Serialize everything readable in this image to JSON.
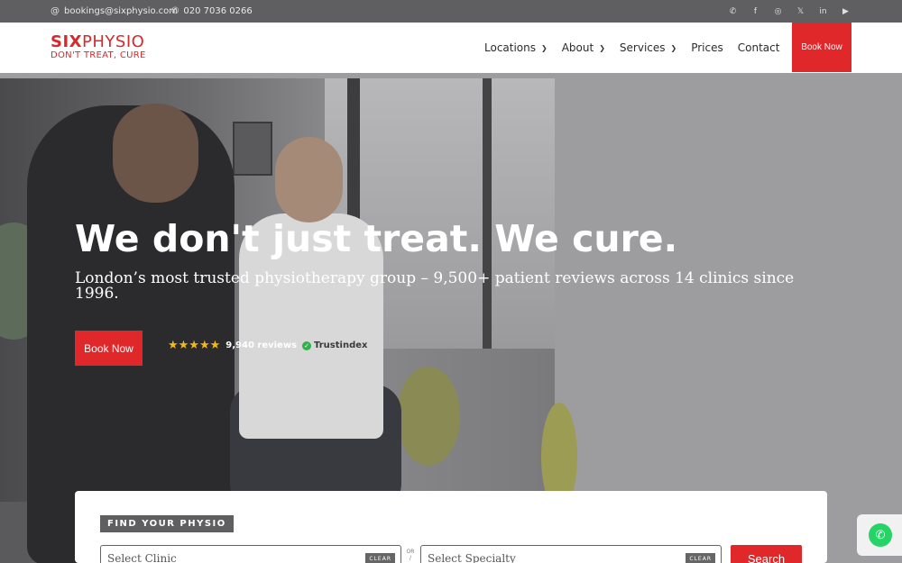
{
  "topbar": {
    "email": "bookings@sixphysio.com",
    "phone": "020 7036 0266",
    "email_icon": "at-icon",
    "phone_icon": "phone-icon",
    "socials": [
      {
        "name": "whatsapp-icon",
        "glyph": "✆"
      },
      {
        "name": "facebook-icon",
        "glyph": "f"
      },
      {
        "name": "instagram-icon",
        "glyph": "◎"
      },
      {
        "name": "x-icon",
        "glyph": "𝕏"
      },
      {
        "name": "linkedin-icon",
        "glyph": "in"
      },
      {
        "name": "youtube-icon",
        "glyph": "▶"
      }
    ]
  },
  "header": {
    "logo_bold": "SIX",
    "logo_rest": "PHYSIO",
    "tagline": "DON'T TREAT, CURE",
    "nav": [
      {
        "label": "Locations",
        "dropdown": true
      },
      {
        "label": "About",
        "dropdown": true
      },
      {
        "label": "Services",
        "dropdown": true
      },
      {
        "label": "Prices",
        "dropdown": false
      },
      {
        "label": "Contact",
        "dropdown": false
      }
    ],
    "book_label": "Book Now"
  },
  "hero": {
    "title": "We don't just treat. We cure.",
    "subtitle": "London’s most trusted physiotherapy group – 9,500+ patient reviews across 14 clinics since 1996.",
    "book_label": "Book Now",
    "stars": "★★★★★",
    "reviews": "9,940 reviews",
    "review_brand": "Trustindex"
  },
  "finder": {
    "label": "FIND YOUR PHYSIO",
    "clinic_placeholder": "Select Clinic",
    "specialty_placeholder": "Select Specialty",
    "clear_label": "CLEAR",
    "or_label": "OR /",
    "search_label": "Search"
  },
  "colors": {
    "brand_red": "#e0272a",
    "topbar_gray": "#5f5f61",
    "whatsapp_green": "#25d366"
  }
}
